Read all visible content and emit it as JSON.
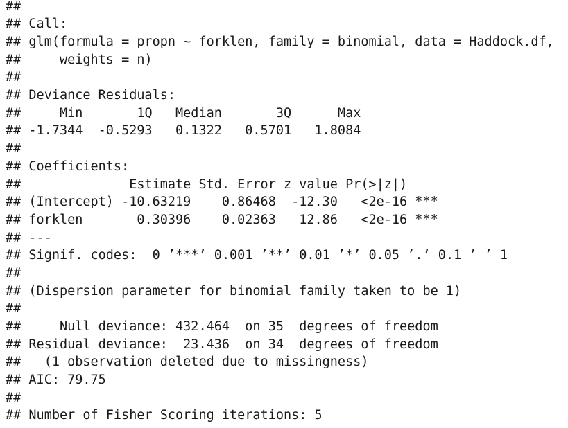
{
  "output_lines": [
    "##",
    "## Call:",
    "## glm(formula = propn ~ forklen, family = binomial, data = Haddock.df,",
    "##     weights = n)",
    "##",
    "## Deviance Residuals:",
    "##     Min       1Q   Median       3Q      Max",
    "## -1.7344  -0.5293   0.1322   0.5701   1.8084",
    "##",
    "## Coefficients:",
    "##              Estimate Std. Error z value Pr(>|z|)",
    "## (Intercept) -10.63219    0.86468  -12.30   <2e-16 ***",
    "## forklen       0.30396    0.02363   12.86   <2e-16 ***",
    "## ---",
    "## Signif. codes:  0 ’***’ 0.001 ’**’ 0.01 ’*’ 0.05 ’.’ 0.1 ’ ’ 1",
    "##",
    "## (Dispersion parameter for binomial family taken to be 1)",
    "##",
    "##     Null deviance: 432.464  on 35  degrees of freedom",
    "## Residual deviance:  23.436  on 34  degrees of freedom",
    "##   (1 observation deleted due to missingness)",
    "## AIC: 79.75",
    "##",
    "## Number of Fisher Scoring iterations: 5"
  ]
}
